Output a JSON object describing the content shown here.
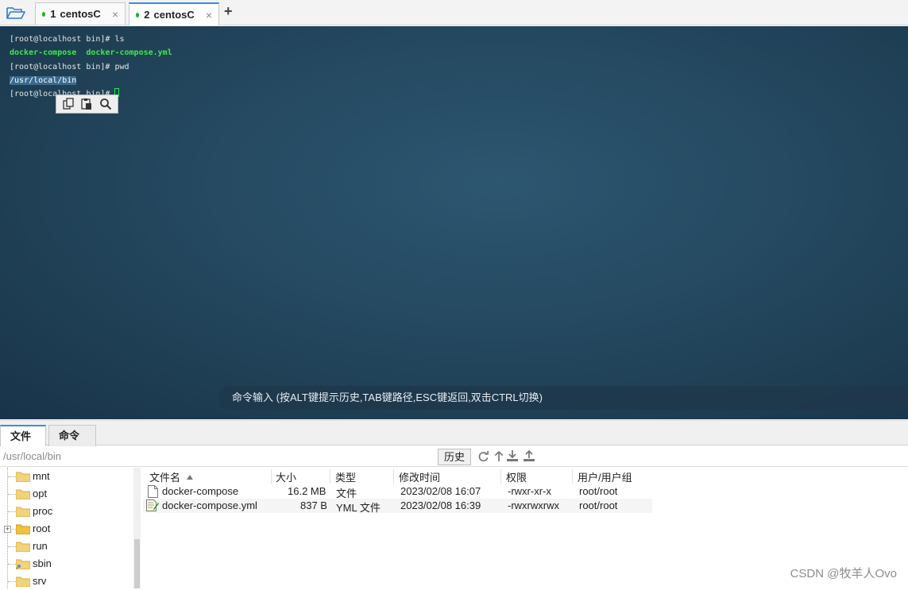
{
  "tabs": [
    {
      "num": "1",
      "label": "centosC",
      "close": "×",
      "status_color": "#1fb31f"
    },
    {
      "num": "2",
      "label": "centosC",
      "close": "×",
      "status_color": "#1fb31f"
    }
  ],
  "new_tab": "+",
  "terminal": {
    "line1": "[root@localhost bin]# ls",
    "line2_a": "docker-compose",
    "line2_b": "docker-compose.yml",
    "line3": "[root@localhost bin]# pwd",
    "line4": "/usr/local/bin",
    "line5": "[root@localhost bin]# ",
    "context_menu": [
      "copy-icon",
      "paste-icon",
      "search-icon"
    ],
    "cmd_placeholder": "命令输入 (按ALT键提示历史,TAB键路径,ESC键返回,双击CTRL切换)",
    "grip": "....",
    "accent_color": "#3ee94b"
  },
  "lower_tabs": [
    "文件",
    "命令"
  ],
  "pathbar": {
    "path": "/usr/local/bin",
    "history": "历史",
    "icons": [
      "refresh-icon",
      "up-dir-icon",
      "download-icon",
      "upload-icon"
    ]
  },
  "tree": [
    {
      "label": "mnt",
      "expandable": false
    },
    {
      "label": "opt",
      "expandable": false
    },
    {
      "label": "proc",
      "expandable": false
    },
    {
      "label": "root",
      "expandable": true
    },
    {
      "label": "run",
      "expandable": false
    },
    {
      "label": "sbin",
      "expandable": false
    },
    {
      "label": "srv",
      "expandable": false
    }
  ],
  "files": {
    "headers": [
      "文件名",
      "大小",
      "类型",
      "修改时间",
      "权限",
      "用户/用户组"
    ],
    "rows": [
      {
        "name": "docker-compose",
        "size": "16.2 MB",
        "type": "文件",
        "mtime": "2023/02/08 16:07",
        "perm": "-rwxr-xr-x",
        "owner": "root/root"
      },
      {
        "name": "docker-compose.yml",
        "size": "837 B",
        "type": "YML 文件",
        "mtime": "2023/02/08 16:39",
        "perm": "-rwxrwxrwx",
        "owner": "root/root"
      }
    ]
  },
  "watermark": "CSDN @牧羊人Ovo"
}
